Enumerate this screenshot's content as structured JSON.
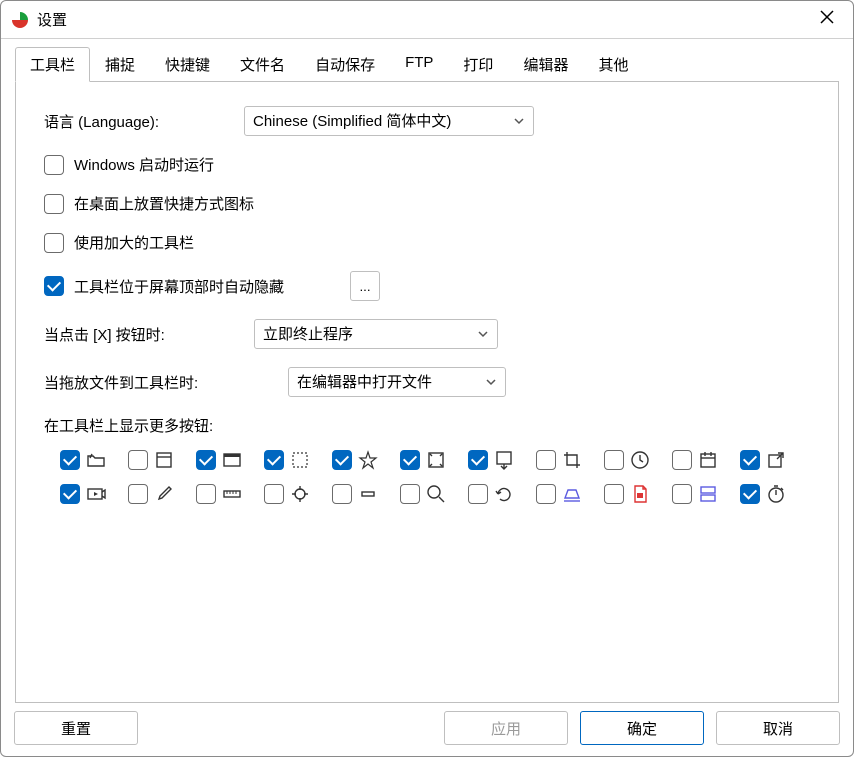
{
  "window": {
    "title": "设置"
  },
  "tabs": [
    "工具栏",
    "捕捉",
    "快捷键",
    "文件名",
    "自动保存",
    "FTP",
    "打印",
    "编辑器",
    "其他"
  ],
  "activeTab": 0,
  "form": {
    "language_label": "语言 (Language):",
    "language_value": "Chinese (Simplified 简体中文)",
    "opt_startup": "Windows 启动时运行",
    "opt_desktop_icon": "在桌面上放置快捷方式图标",
    "opt_large_toolbar": "使用加大的工具栏",
    "opt_autohide": "工具栏位于屏幕顶部时自动隐藏",
    "ellipsis": "...",
    "close_label": "当点击 [X] 按钮时:",
    "close_value": "立即终止程序",
    "drag_label": "当拖放文件到工具栏时:",
    "drag_value": "在编辑器中打开文件",
    "more_buttons_label": "在工具栏上显示更多按钮:",
    "checks": {
      "startup": false,
      "desktop": false,
      "large": false,
      "autohide": true
    }
  },
  "toolbarIcons": [
    {
      "name": "folder-open-icon",
      "checked": true
    },
    {
      "name": "window-icon",
      "checked": false
    },
    {
      "name": "application-icon",
      "checked": true
    },
    {
      "name": "selection-icon",
      "checked": true
    },
    {
      "name": "star-icon",
      "checked": true
    },
    {
      "name": "fullscreen-icon",
      "checked": true
    },
    {
      "name": "scroll-capture-icon",
      "checked": true
    },
    {
      "name": "crop-icon",
      "checked": false
    },
    {
      "name": "clock-icon",
      "checked": false
    },
    {
      "name": "calendar-icon",
      "checked": false
    },
    {
      "name": "share-icon",
      "checked": true
    },
    {
      "name": "play-icon",
      "checked": true
    },
    {
      "name": "color-picker-icon",
      "checked": false
    },
    {
      "name": "ruler-icon",
      "checked": false
    },
    {
      "name": "crosshair-icon",
      "checked": false
    },
    {
      "name": "minus-icon",
      "checked": false
    },
    {
      "name": "zoom-icon",
      "checked": false
    },
    {
      "name": "undo-icon",
      "checked": false
    },
    {
      "name": "scanner-icon",
      "checked": false
    },
    {
      "name": "pdf-icon",
      "checked": false
    },
    {
      "name": "split-icon",
      "checked": false
    },
    {
      "name": "stopwatch-icon",
      "checked": true
    }
  ],
  "footer": {
    "reset": "重置",
    "apply": "应用",
    "ok": "确定",
    "cancel": "取消"
  }
}
